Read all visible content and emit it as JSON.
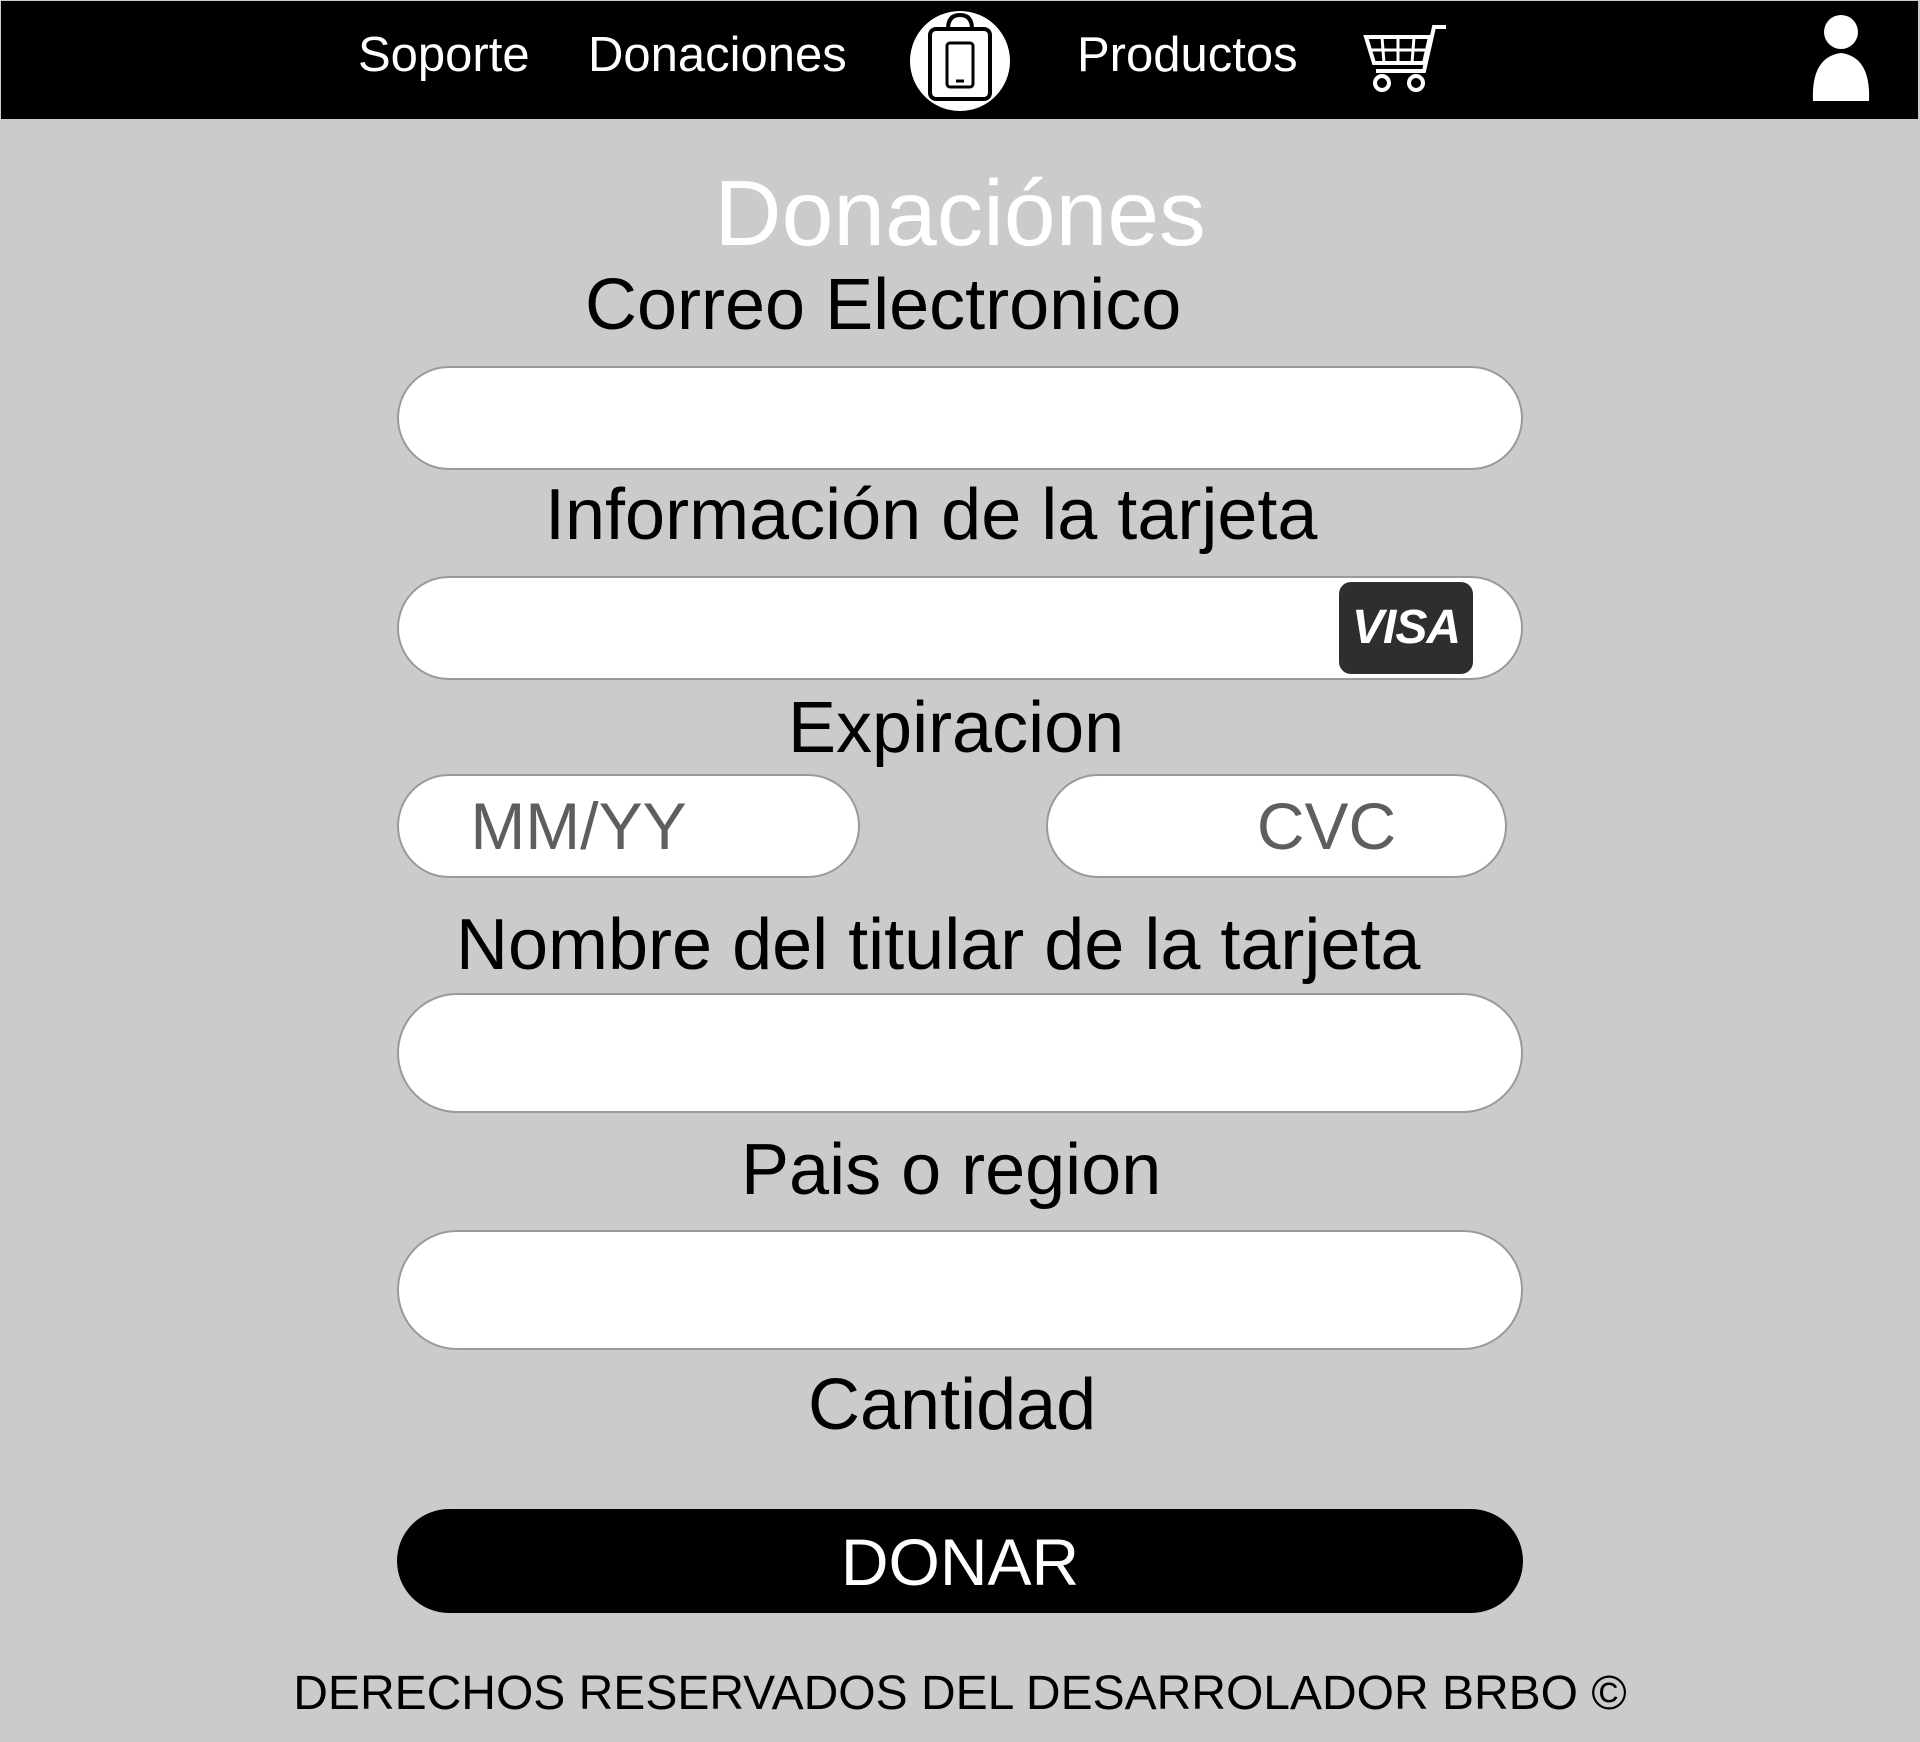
{
  "nav": {
    "links": [
      "Soporte",
      "Donaciones",
      "Productos"
    ],
    "logo_icon": "shopping-bag-phone-icon",
    "cart_icon": "shopping-cart-icon",
    "user_icon": "user-icon"
  },
  "page": {
    "title": "Donaciónes"
  },
  "form": {
    "email_label": "Correo Electronico",
    "email_value": "",
    "card_label": "Información de la tarjeta",
    "card_value": "",
    "card_brand": "VISA",
    "expiration_label": "Expiracion",
    "expiration_placeholder": "MM/YY",
    "cvc_placeholder": "CVC",
    "holder_label": "Nombre del titular de la tarjeta",
    "holder_value": "",
    "country_label": "Pais o region",
    "country_value": "",
    "amount_label": "Cantidad",
    "submit_label": "DONAR"
  },
  "footer": {
    "text": "DERECHOS RESERVADOS DEL DESARROLADOR BRBO ©"
  },
  "colors": {
    "background": "#cbcbcb",
    "navbar": "#000000",
    "title": "#ffffff",
    "button": "#000000"
  }
}
